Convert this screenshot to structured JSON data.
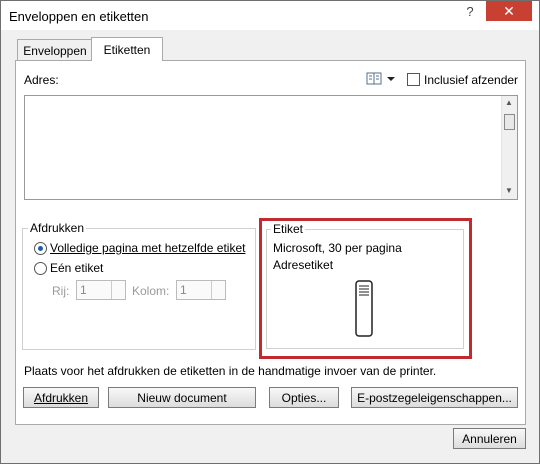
{
  "window": {
    "title": "Enveloppen en etiketten",
    "help_glyph": "?",
    "close_glyph": "✕"
  },
  "tabs": [
    {
      "label": "Enveloppen",
      "active": false
    },
    {
      "label": "Etiketten",
      "active": true
    }
  ],
  "address": {
    "label": "Adres:",
    "value": "",
    "include_sender_label": "Inclusief afzender",
    "include_sender_checked": false
  },
  "print_group": {
    "title": "Afdrukken",
    "options": [
      {
        "label": "Volledige pagina met hetzelfde etiket",
        "checked": true
      },
      {
        "label": "Eén etiket",
        "checked": false
      }
    ],
    "row_label": "Rij:",
    "row_value": "1",
    "col_label": "Kolom:",
    "col_value": "1"
  },
  "label_group": {
    "title": "Etiket",
    "line1": "Microsoft, 30 per pagina",
    "line2": "Adresetiket"
  },
  "info_text": "Plaats voor het afdrukken de etiketten in de handmatige invoer van de printer.",
  "buttons": {
    "print": "Afdrukken",
    "new_document": "Nieuw document",
    "options": "Opties...",
    "epostage": "E-postzegeleigenschappen...",
    "cancel": "Annuleren"
  },
  "colors": {
    "highlight": "#c22a2f",
    "close_button": "#c84031",
    "radio_dot": "#1c5fa8"
  }
}
